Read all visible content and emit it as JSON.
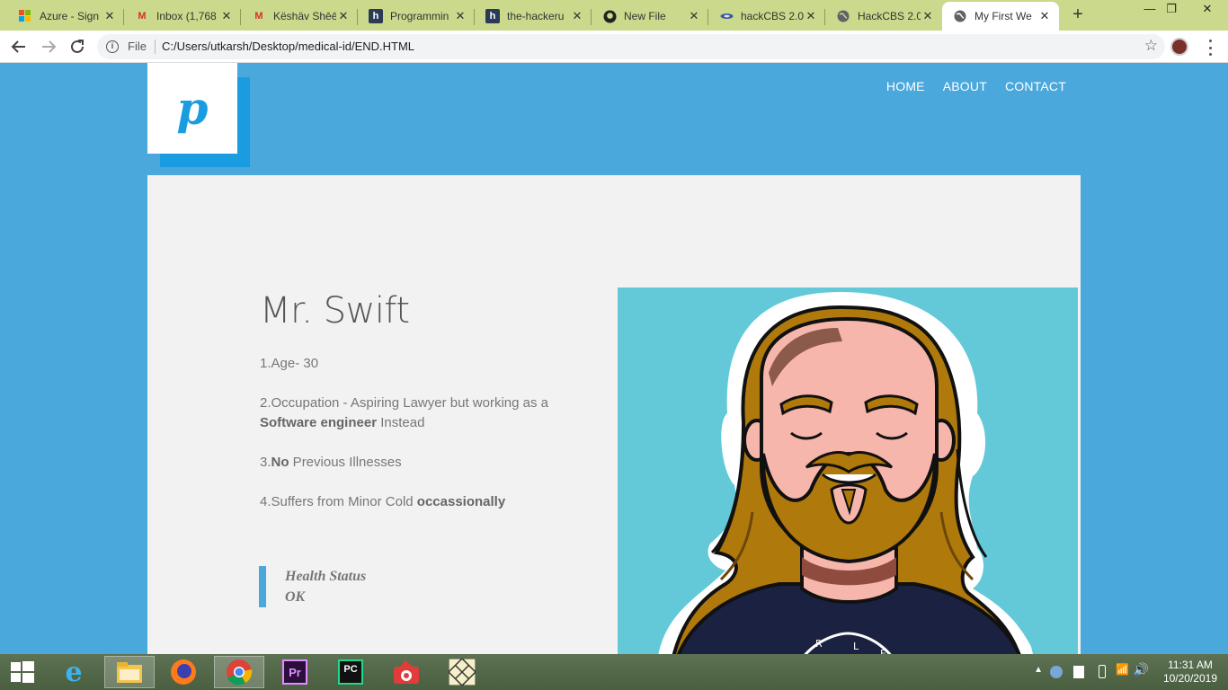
{
  "browser": {
    "tabs": [
      {
        "title": "Azure - Sign",
        "icon": "microsoft-icon"
      },
      {
        "title": "Inbox (1,768",
        "icon": "gmail-icon"
      },
      {
        "title": "Këshäv Shēē",
        "icon": "gmail-icon"
      },
      {
        "title": "Programmin",
        "icon": "hackerrank-icon"
      },
      {
        "title": "the-hackeru",
        "icon": "hackerrank-icon"
      },
      {
        "title": "New File",
        "icon": "github-icon"
      },
      {
        "title": "hackCBS 2.0",
        "icon": "hackcbs-icon"
      },
      {
        "title": "HackCBS 2.0",
        "icon": "globe-icon"
      },
      {
        "title": "My First We",
        "icon": "globe-icon",
        "active": true
      }
    ],
    "address": {
      "scheme_label": "File",
      "url": "C:/Users/utkarsh/Desktop/medical-id/END.HTML"
    }
  },
  "site": {
    "logo_letter": "p",
    "nav": [
      "HOME",
      "ABOUT",
      "CONTACT"
    ],
    "person_name": "Mr. Swift",
    "facts": [
      {
        "before": "1.Age- 30",
        "bold": "",
        "after": ""
      },
      {
        "before": "2.Occupation - Aspiring Lawyer but working as a ",
        "bold": "Software engineer",
        "after": " Instead"
      },
      {
        "before": "3.",
        "bold": "No",
        "after": " Previous Illnesses"
      },
      {
        "before": "4.Suffers from Minor Cold ",
        "bold": "occassionally",
        "after": ""
      }
    ],
    "status_label": "Health Status",
    "status_value": "OK",
    "colors": {
      "accent": "#1a9de0",
      "background": "#4aa8dc",
      "portrait_bg": "#63c9d8"
    }
  },
  "taskbar": {
    "apps": [
      "start-icon",
      "internet-explorer-icon",
      "file-explorer-icon",
      "firefox-icon",
      "chrome-icon",
      "premiere-pro-icon",
      "pycharm-icon",
      "camera-app-icon",
      "pattern-app-icon"
    ],
    "time": "11:31 AM",
    "date": "10/20/2019"
  }
}
